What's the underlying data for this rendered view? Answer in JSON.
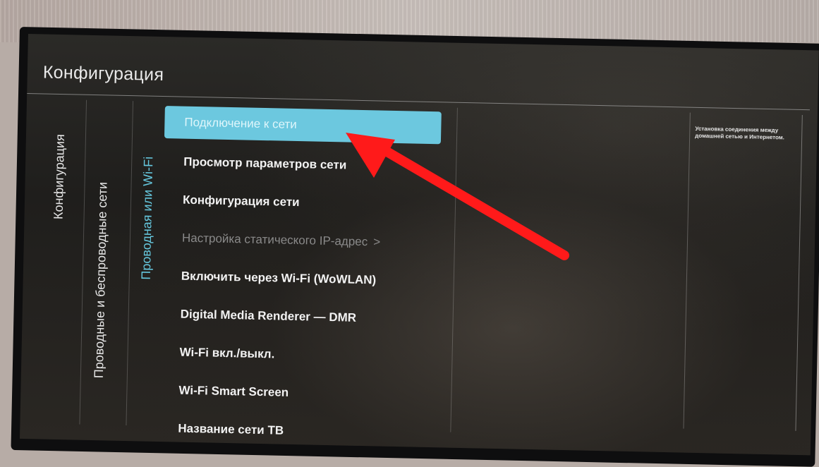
{
  "title": "Конфигурация",
  "breadcrumb": [
    {
      "label": "Конфигурация"
    },
    {
      "label": "Проводные и беспроводные сети"
    },
    {
      "label": "Проводная или Wi-Fi"
    }
  ],
  "menu": {
    "items": [
      {
        "label": "Подключение к сети",
        "state": "selected"
      },
      {
        "label": "Просмотр параметров сети",
        "state": "normal"
      },
      {
        "label": "Конфигурация сети",
        "state": "normal"
      },
      {
        "label": "Настройка статического IP-адрес",
        "state": "disabled",
        "chevron": ">"
      },
      {
        "label": "Включить через Wi-Fi (WoWLAN)",
        "state": "normal"
      },
      {
        "label": "Digital Media Renderer — DMR",
        "state": "normal"
      },
      {
        "label": "Wi-Fi вкл./выкл.",
        "state": "normal"
      },
      {
        "label": "Wi-Fi Smart Screen",
        "state": "normal"
      },
      {
        "label": "Название сети ТВ",
        "state": "normal"
      }
    ]
  },
  "help_text": "Установка соединения между домашней сетью и Интернетом.",
  "colors": {
    "accent": "#6cc8df",
    "active_tab": "#66c8df",
    "annotation_arrow": "#ff1a1a"
  },
  "icons": {
    "arrow": "arrow-annotation-icon",
    "chevron": "chevron-right-icon"
  }
}
